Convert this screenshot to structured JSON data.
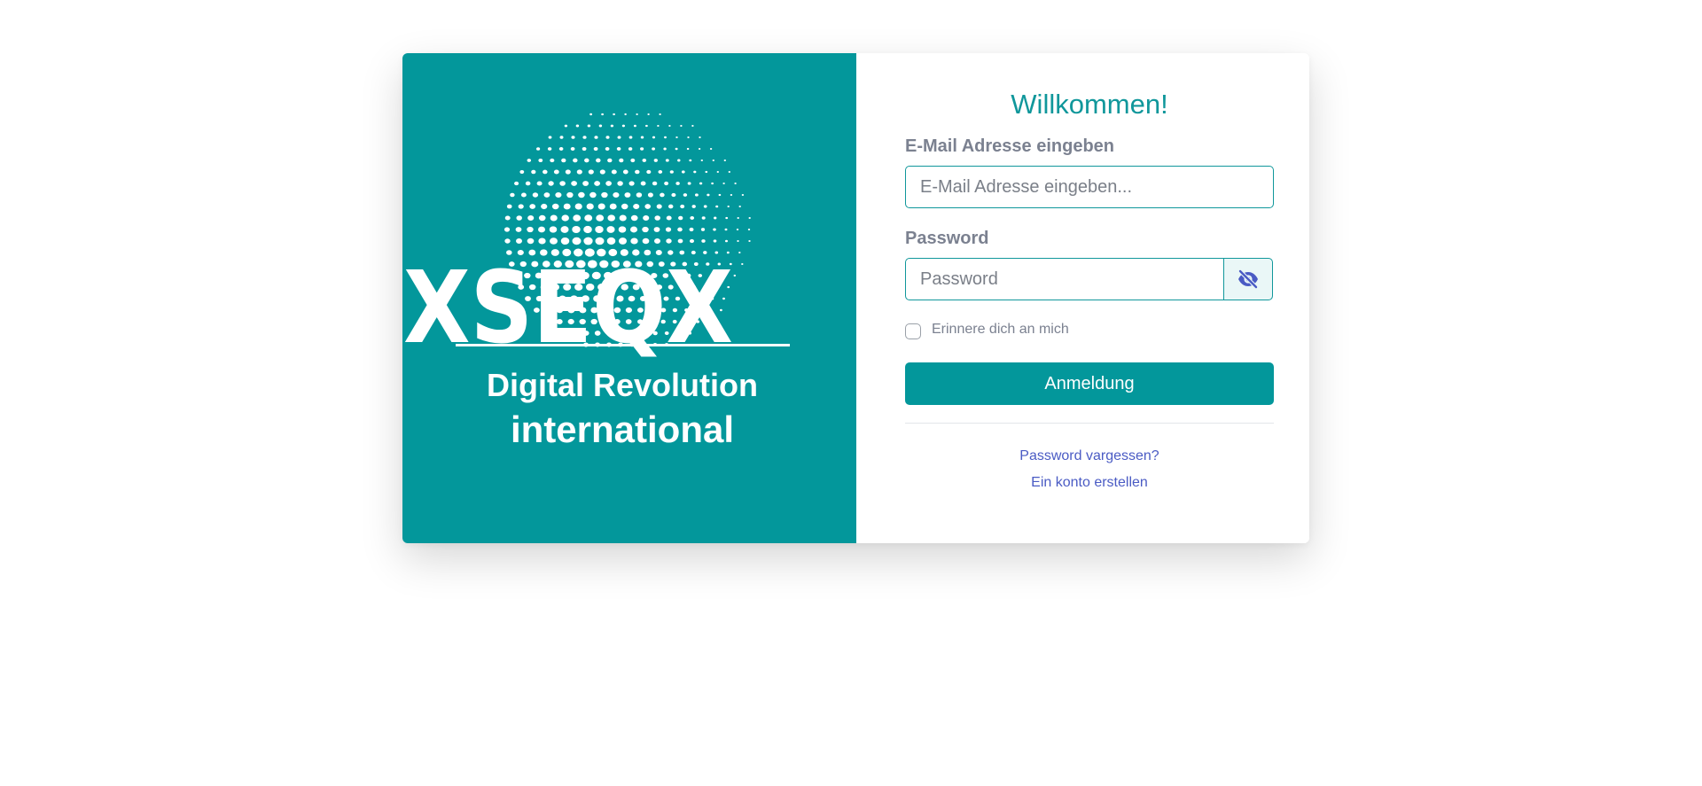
{
  "brand": {
    "logo_text": "XSEQX",
    "tagline_line1": "Digital Revolution",
    "tagline_line2": "international",
    "background_color": "#03979b",
    "text_color": "#ffffff"
  },
  "login": {
    "title": "Willkommen!",
    "email": {
      "label": "E-Mail Adresse eingeben",
      "placeholder": "E-Mail Adresse eingeben...",
      "value": ""
    },
    "password": {
      "label": "Password",
      "placeholder": "Password",
      "value": "",
      "toggle_icon": "eye-slash-icon"
    },
    "remember_me": {
      "label": "Erinnere dich an mich",
      "checked": false
    },
    "submit_label": "Anmeldung",
    "forgot_password_link": "Password vargessen?",
    "create_account_link": "Ein konto erstellen"
  },
  "colors": {
    "accent": "#03979b",
    "title": "#10979b",
    "label": "#7b8190",
    "link": "#4a5bc4"
  }
}
